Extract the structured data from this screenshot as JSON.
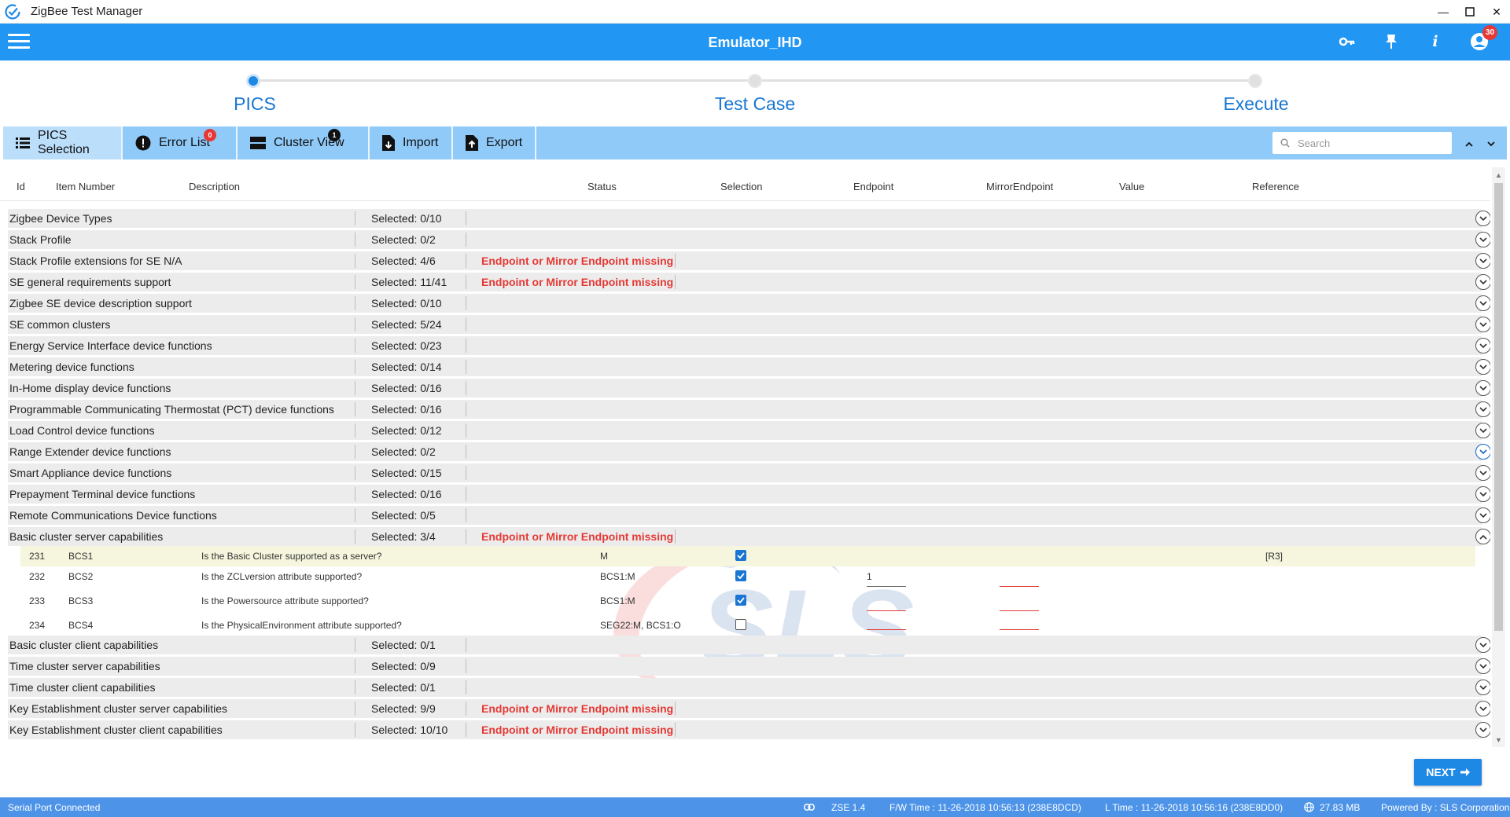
{
  "window": {
    "title": "ZigBee Test Manager"
  },
  "header": {
    "title": "Emulator_IHD",
    "notification_count": "30"
  },
  "steps": [
    "PICS",
    "Test Case",
    "Execute"
  ],
  "toolbar": {
    "pics_selection": "PICS Selection",
    "error_list": "Error List",
    "error_badge": "0",
    "cluster_view": "Cluster View",
    "cluster_badge": "1",
    "import": "Import",
    "export": "Export",
    "search_placeholder": "Search"
  },
  "columns": {
    "id": "Id",
    "item_number": "Item Number",
    "description": "Description",
    "status": "Status",
    "selection": "Selection",
    "endpoint": "Endpoint",
    "mirror_endpoint": "MirrorEndpoint",
    "value": "Value",
    "reference": "Reference"
  },
  "groups_top": [
    {
      "name": "Zigbee Device Types",
      "selected": "Selected: 0/10",
      "error": ""
    },
    {
      "name": "Stack Profile",
      "selected": "Selected: 0/2",
      "error": ""
    },
    {
      "name": "Stack Profile extensions for SE N/A",
      "selected": "Selected: 4/6",
      "error": "Endpoint or Mirror Endpoint missing"
    },
    {
      "name": "SE general requirements support",
      "selected": "Selected: 11/41",
      "error": "Endpoint or Mirror Endpoint missing"
    },
    {
      "name": "Zigbee SE device description support",
      "selected": "Selected: 0/10",
      "error": ""
    },
    {
      "name": "SE common clusters",
      "selected": "Selected: 5/24",
      "error": ""
    },
    {
      "name": "Energy Service Interface device functions",
      "selected": "Selected: 0/23",
      "error": ""
    },
    {
      "name": "Metering device functions",
      "selected": "Selected: 0/14",
      "error": ""
    },
    {
      "name": "In-Home display device functions",
      "selected": "Selected: 0/16",
      "error": ""
    },
    {
      "name": "Programmable Communicating Thermostat (PCT) device functions",
      "selected": "Selected: 0/16",
      "error": ""
    },
    {
      "name": "Load Control device functions",
      "selected": "Selected: 0/12",
      "error": ""
    },
    {
      "name": "Range Extender device functions",
      "selected": "Selected: 0/2",
      "error": ""
    },
    {
      "name": "Smart Appliance device functions",
      "selected": "Selected: 0/15",
      "error": ""
    },
    {
      "name": "Prepayment Terminal device functions",
      "selected": "Selected: 0/16",
      "error": ""
    },
    {
      "name": "Remote Communications Device functions",
      "selected": "Selected: 0/5",
      "error": ""
    },
    {
      "name": "Basic cluster server capabilities",
      "selected": "Selected: 3/4",
      "error": "Endpoint or Mirror Endpoint missing"
    }
  ],
  "sub_rows": [
    {
      "id": "231",
      "item": "BCS1",
      "description": "Is the Basic Cluster supported as a server?",
      "status": "M",
      "selected": true,
      "endpoint": "",
      "reference": "[R3]"
    },
    {
      "id": "232",
      "item": "BCS2",
      "description": "Is the ZCLversion attribute supported?",
      "status": "BCS1:M",
      "selected": true,
      "endpoint": "1",
      "reference": ""
    },
    {
      "id": "233",
      "item": "BCS3",
      "description": "Is the Powersource attribute supported?",
      "status": "BCS1:M",
      "selected": true,
      "endpoint": "",
      "reference": ""
    },
    {
      "id": "234",
      "item": "BCS4",
      "description": "Is the PhysicalEnvironment attribute supported?",
      "status": "SEG22:M, BCS1:O",
      "selected": false,
      "endpoint": "",
      "reference": ""
    }
  ],
  "groups_bottom": [
    {
      "name": "Basic cluster client capabilities",
      "selected": "Selected: 0/1",
      "error": ""
    },
    {
      "name": "Time cluster server capabilities",
      "selected": "Selected: 0/9",
      "error": ""
    },
    {
      "name": "Time cluster client capabilities",
      "selected": "Selected: 0/1",
      "error": ""
    },
    {
      "name": "Key Establishment cluster server capabilities",
      "selected": "Selected: 9/9",
      "error": "Endpoint or Mirror Endpoint missing"
    },
    {
      "name": "Key Establishment cluster client capabilities",
      "selected": "Selected: 10/10",
      "error": "Endpoint or Mirror Endpoint missing"
    }
  ],
  "watermark": "SLS",
  "next_button": "NEXT",
  "status": {
    "connection": "Serial Port Connected",
    "zse": "ZSE 1.4",
    "fw_time": "F/W Time : 11-26-2018 10:56:13 (238E8DCD)",
    "l_time": "L Time : 11-26-2018 10:56:16 (238E8DD0)",
    "memory": "27.83 MB",
    "powered_by": "Powered By : SLS Corporation"
  },
  "colors": {
    "primary": "#2196f3",
    "toolbar": "#90caf9",
    "error": "#e53935",
    "status_bar": "#4d94e8"
  }
}
